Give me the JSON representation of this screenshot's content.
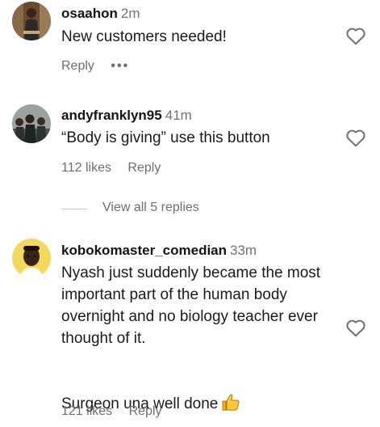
{
  "comments": [
    {
      "username": "osaahon",
      "time": "2m",
      "text": "New customers needed!",
      "likes": "",
      "reply_label": "Reply",
      "more_icon": "more-dots-icon"
    },
    {
      "username": "andyfranklyn95",
      "time": "41m",
      "text": "“Body is giving” use this button",
      "likes": "112 likes",
      "reply_label": "Reply"
    },
    {
      "username": "kobokomaster_comedian",
      "time": "33m",
      "text": "Nyash just suddenly became the most important part of the human body overnight and no biology teacher ever thought of it.",
      "text2": "Surgeon una well done",
      "emoji": "thumbs-up-icon",
      "likes": "121 likes",
      "reply_label": "Reply"
    }
  ],
  "view_replies": "View all 5 replies",
  "icons": {
    "like": "heart-outline-icon"
  },
  "colors": {
    "muted": "#737373",
    "text": "#141414"
  }
}
